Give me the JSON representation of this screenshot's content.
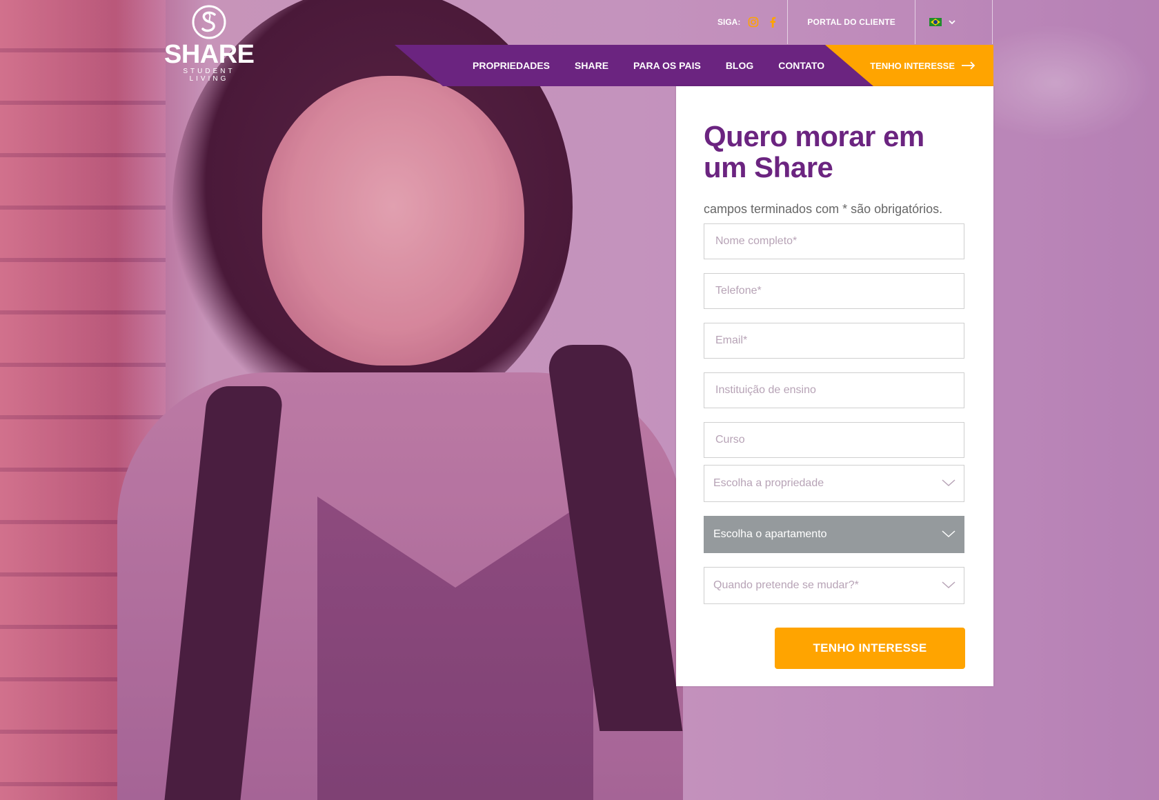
{
  "brand": {
    "name": "SHARE",
    "tagline": "STUDENT LIVING"
  },
  "topbar": {
    "follow_label": "SIGA:",
    "portal_label": "PORTAL DO CLIENTE",
    "language": "Português (Brasil)"
  },
  "nav": {
    "items": [
      {
        "label": "PROPRIEDADES"
      },
      {
        "label": "SHARE"
      },
      {
        "label": "PARA OS PAIS"
      },
      {
        "label": "BLOG"
      },
      {
        "label": "CONTATO"
      }
    ],
    "cta_label": "TENHO INTERESSE"
  },
  "form": {
    "title": "Quero morar em um Share",
    "note": "campos terminados com * são obrigatórios.",
    "fields": {
      "name_placeholder": "Nome completo*",
      "phone_placeholder": "Telefone*",
      "email_placeholder": "Email*",
      "institution_placeholder": "Instituição de ensino",
      "course_placeholder": "Curso"
    },
    "selects": {
      "property": "Escolha a propriedade",
      "apartment": "Escolha o apartamento",
      "move_date": "Quando pretende se mudar?*"
    },
    "submit_label": "TENHO INTERESSE"
  },
  "colors": {
    "brand_purple": "#6b2480",
    "accent_orange": "#ffa400",
    "disabled_gray": "#959a9d"
  },
  "icons": [
    "share-logo-icon",
    "instagram-icon",
    "facebook-icon",
    "brazil-flag-icon",
    "chevron-down-icon",
    "arrow-right-icon"
  ]
}
